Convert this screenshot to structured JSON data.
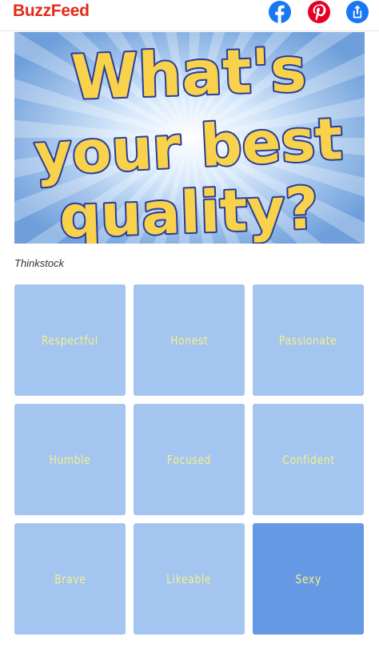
{
  "header": {
    "brand": "BuzzFeed",
    "share_icons": [
      "facebook-icon",
      "pinterest-icon",
      "share-icon"
    ]
  },
  "hero": {
    "lines": [
      "What's",
      "your best",
      "quality?"
    ],
    "text_color": "#f7d24a",
    "outline_color": "#2b3c98"
  },
  "credit": "Thinkstock",
  "answers": [
    {
      "label": "Respectful",
      "selected": false
    },
    {
      "label": "Honest",
      "selected": false
    },
    {
      "label": "Passionate",
      "selected": false
    },
    {
      "label": "Humble",
      "selected": false
    },
    {
      "label": "Focused",
      "selected": false
    },
    {
      "label": "Confident",
      "selected": false
    },
    {
      "label": "Brave",
      "selected": false
    },
    {
      "label": "Likeable",
      "selected": false
    },
    {
      "label": "Sexy",
      "selected": true
    }
  ],
  "colors": {
    "brand": "#e32a19",
    "tile": "#a3c5ef",
    "tile_selected": "#6699e3",
    "tile_text": "#f5f08a"
  }
}
